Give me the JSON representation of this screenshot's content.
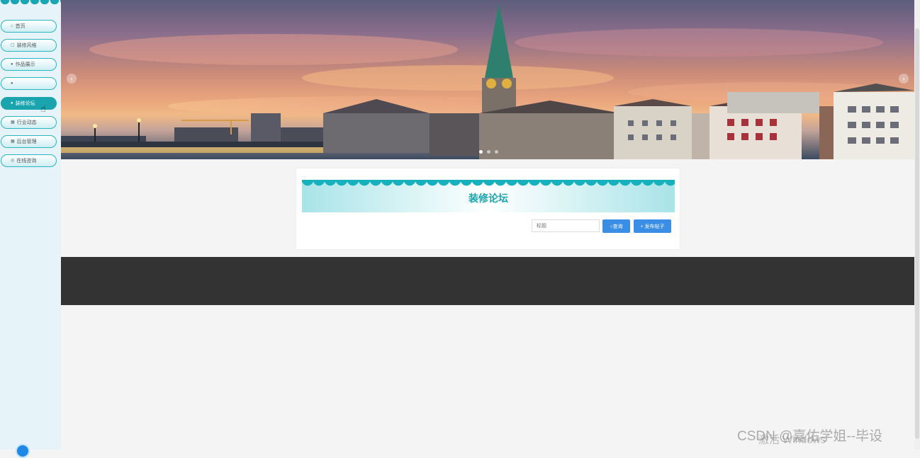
{
  "sidebar": {
    "items": [
      {
        "label": "首页",
        "icon": "home-icon",
        "glyph": "⌂"
      },
      {
        "label": "装修风格",
        "icon": "lock-icon",
        "glyph": "▢"
      },
      {
        "label": "作品展示",
        "icon": "circle-icon",
        "glyph": "●"
      },
      {
        "label": "",
        "icon": "circle-icon",
        "glyph": "●"
      },
      {
        "label": "装修论坛",
        "icon": "circle-icon",
        "glyph": "●",
        "active": true
      },
      {
        "label": "行业动态",
        "icon": "grid-icon",
        "glyph": "▦"
      },
      {
        "label": "后台管理",
        "icon": "grid-icon",
        "glyph": "▦"
      },
      {
        "label": "在线咨询",
        "icon": "chat-icon",
        "glyph": "◎"
      }
    ]
  },
  "banner": {
    "prev_arrow": "‹",
    "next_arrow": "›",
    "slide_count": 3,
    "active_slide": 1
  },
  "forum": {
    "title": "装修论坛",
    "search_placeholder": "标题",
    "search_button": "○查询",
    "post_button": "+ 发布帖子"
  },
  "watermark": {
    "csdn": "CSDN @嘉佑学姐--毕设",
    "windows": "激活 Windows"
  },
  "colors": {
    "accent": "#1aa4ae",
    "button": "#3a8ee6",
    "footer": "#333333",
    "sidebar_bg": "#e6f3f8"
  }
}
